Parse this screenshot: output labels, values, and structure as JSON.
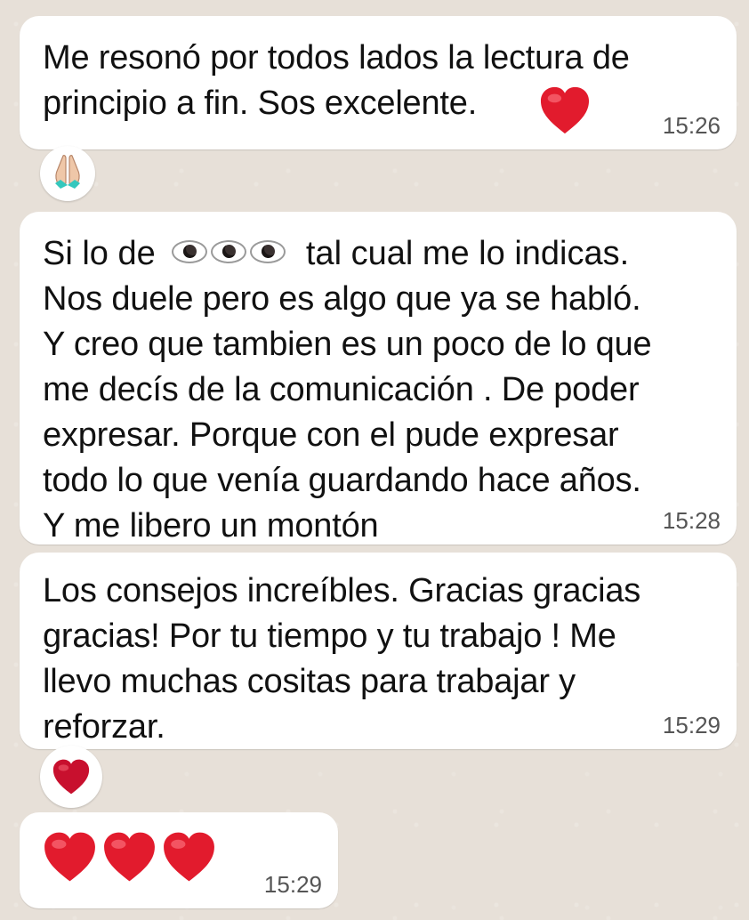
{
  "messages": [
    {
      "id": "m1",
      "text": "Me resonó por todos lados la lectura de\nprincipio a fin.  Sos excelente.",
      "time": "15:26",
      "reaction_icon": "folded-hands-icon",
      "inline_icon": "red-heart-icon"
    },
    {
      "id": "m2",
      "line1_before": "Si lo de",
      "line1_after": "tal cual me lo indicas.",
      "inline_icon": "eyes-icon",
      "text": "Nos duele pero es algo que ya se habló.\nY creo que tambien es un poco de lo que\nme decís de la comunicación . De poder\nexpresar. Porque con el pude expresar\ntodo lo que venía guardando hace años.\nY me libero un montón",
      "time": "15:28"
    },
    {
      "id": "m3",
      "text": "Los consejos increíbles. Gracias gracias\ngracias! Por tu tiempo y tu trabajo ! Me\nllevo muchas cositas para trabajar y\nreforzar.",
      "time": "15:29",
      "reaction_icon": "heart-reaction-icon"
    },
    {
      "id": "m4",
      "content_icon": "three-red-hearts-icon",
      "time": "15:29"
    }
  ],
  "colors": {
    "background": "#e7e0d8",
    "bubble": "#ffffff",
    "heart": "#e21b2d",
    "time": "#555555"
  }
}
